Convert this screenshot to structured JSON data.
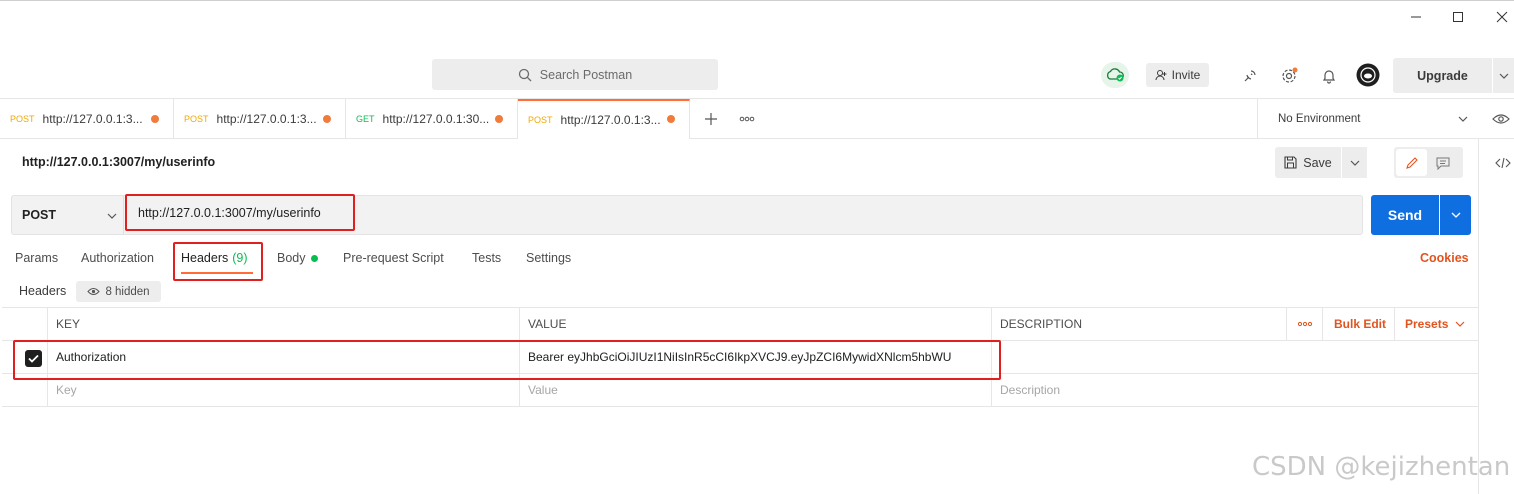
{
  "window": {
    "minimize": "—",
    "maximize": "☐",
    "close": "✕"
  },
  "header": {
    "search_placeholder": "Search Postman",
    "invite_label": "Invite",
    "upgrade_label": "Upgrade"
  },
  "tabs": [
    {
      "method": "POST",
      "label": "http://127.0.0.1:3..."
    },
    {
      "method": "POST",
      "label": "http://127.0.0.1:3..."
    },
    {
      "method": "GET",
      "label": "http://127.0.0.1:30..."
    },
    {
      "method": "POST",
      "label": "http://127.0.0.1:3..."
    }
  ],
  "environment": {
    "selected": "No Environment"
  },
  "request": {
    "title": "http://127.0.0.1:3007/my/userinfo",
    "save_label": "Save",
    "method": "POST",
    "url": "http://127.0.0.1:3007/my/userinfo",
    "send_label": "Send"
  },
  "request_tabs": {
    "params": "Params",
    "authorization": "Authorization",
    "headers": "Headers",
    "headers_count": "(9)",
    "body": "Body",
    "prerequest": "Pre-request Script",
    "tests": "Tests",
    "settings": "Settings",
    "cookies": "Cookies"
  },
  "headers_section": {
    "label": "Headers",
    "hidden": "8 hidden"
  },
  "table": {
    "columns": {
      "key": "KEY",
      "value": "VALUE",
      "description": "DESCRIPTION"
    },
    "bulk_edit": "Bulk Edit",
    "presets": "Presets",
    "rows": [
      {
        "key": "Authorization",
        "value": "Bearer eyJhbGciOiJIUzI1NiIsInR5cCI6IkpXVCJ9.eyJpZCI6MywidXNlcm5hbWU",
        "description": ""
      }
    ],
    "placeholder": {
      "key": "Key",
      "value": "Value",
      "description": "Description"
    }
  },
  "watermark": "CSDN @kejizhentan",
  "colors": {
    "accent": "#ff6c37",
    "send": "#0f6fe0",
    "annotation": "#e21f1f",
    "post": "#f0a800",
    "get": "#0cbb52"
  }
}
